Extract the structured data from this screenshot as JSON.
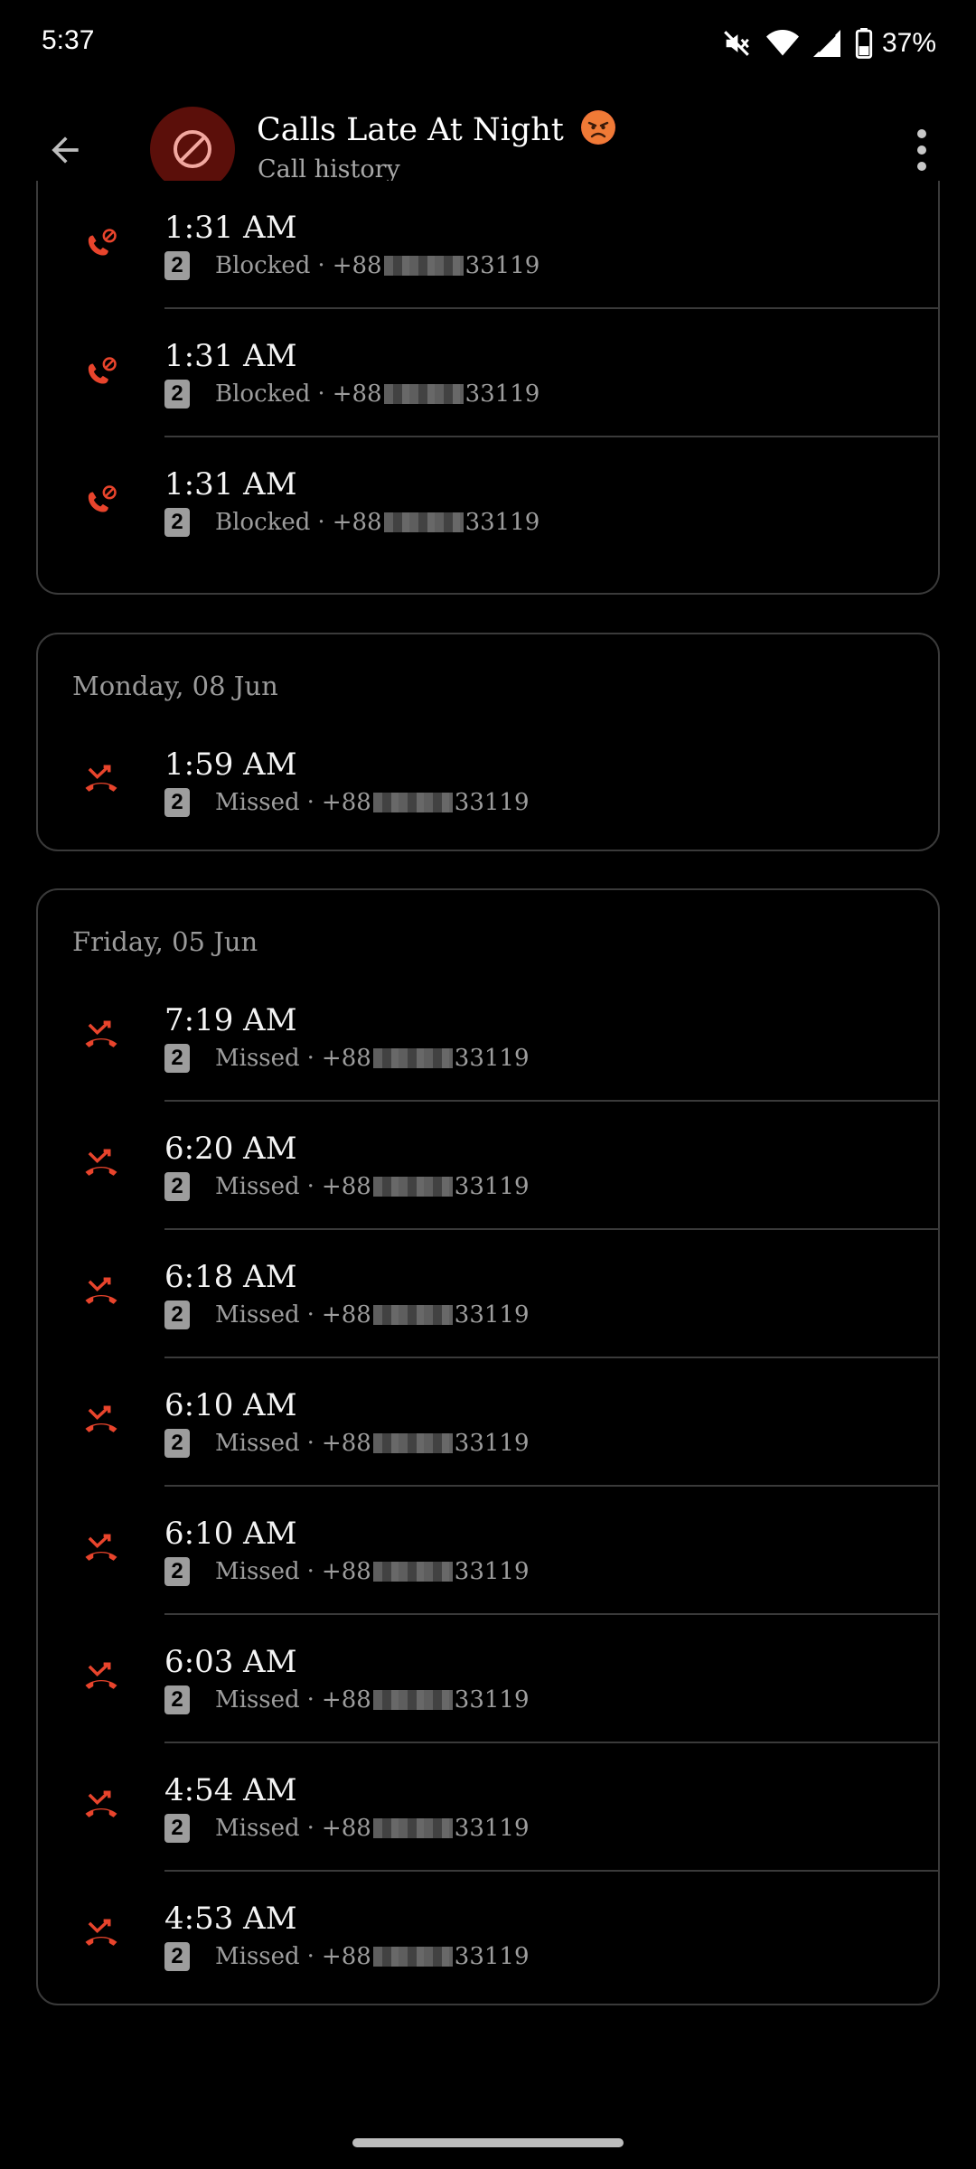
{
  "status_bar": {
    "time": "5:37",
    "battery": "37%",
    "icons": [
      "mute-icon",
      "wifi-icon",
      "cellular-signal-icon",
      "battery-icon"
    ]
  },
  "header": {
    "title": "Calls Late At Night",
    "title_emoji": "angry-face-emoji",
    "subtitle": "Call history",
    "avatar_icon": "block-icon",
    "avatar_color": "#5b0f0a"
  },
  "colors": {
    "call_icon_red": "#e8442c",
    "card_border": "#3a3a3a",
    "secondary_text": "#9d9d9d"
  },
  "groups": [
    {
      "date": "",
      "calls": [
        {
          "time": "1:31 AM",
          "sim": "2",
          "status": "Blocked",
          "sep": "·",
          "number_prefix": "+88",
          "number_suffix": "33119",
          "icon": "blocked-call-icon"
        },
        {
          "time": "1:31 AM",
          "sim": "2",
          "status": "Blocked",
          "sep": "·",
          "number_prefix": "+88",
          "number_suffix": "33119",
          "icon": "blocked-call-icon"
        },
        {
          "time": "1:31 AM",
          "sim": "2",
          "status": "Blocked",
          "sep": "·",
          "number_prefix": "+88",
          "number_suffix": "33119",
          "icon": "blocked-call-icon"
        }
      ]
    },
    {
      "date": "Monday, 08 Jun",
      "calls": [
        {
          "time": "1:59 AM",
          "sim": "2",
          "status": "Missed",
          "sep": "·",
          "number_prefix": "+88",
          "number_suffix": "33119",
          "icon": "missed-call-icon"
        }
      ]
    },
    {
      "date": "Friday, 05 Jun",
      "calls": [
        {
          "time": "7:19 AM",
          "sim": "2",
          "status": "Missed",
          "sep": "·",
          "number_prefix": "+88",
          "number_suffix": "33119",
          "icon": "missed-call-icon"
        },
        {
          "time": "6:20 AM",
          "sim": "2",
          "status": "Missed",
          "sep": "·",
          "number_prefix": "+88",
          "number_suffix": "33119",
          "icon": "missed-call-icon"
        },
        {
          "time": "6:18 AM",
          "sim": "2",
          "status": "Missed",
          "sep": "·",
          "number_prefix": "+88",
          "number_suffix": "33119",
          "icon": "missed-call-icon"
        },
        {
          "time": "6:10 AM",
          "sim": "2",
          "status": "Missed",
          "sep": "·",
          "number_prefix": "+88",
          "number_suffix": "33119",
          "icon": "missed-call-icon"
        },
        {
          "time": "6:10 AM",
          "sim": "2",
          "status": "Missed",
          "sep": "·",
          "number_prefix": "+88",
          "number_suffix": "33119",
          "icon": "missed-call-icon"
        },
        {
          "time": "6:03 AM",
          "sim": "2",
          "status": "Missed",
          "sep": "·",
          "number_prefix": "+88",
          "number_suffix": "33119",
          "icon": "missed-call-icon"
        },
        {
          "time": "4:54 AM",
          "sim": "2",
          "status": "Missed",
          "sep": "·",
          "number_prefix": "+88",
          "number_suffix": "33119",
          "icon": "missed-call-icon"
        },
        {
          "time": "4:53 AM",
          "sim": "2",
          "status": "Missed",
          "sep": "·",
          "number_prefix": "+88",
          "number_suffix": "33119",
          "icon": "missed-call-icon"
        }
      ]
    }
  ]
}
